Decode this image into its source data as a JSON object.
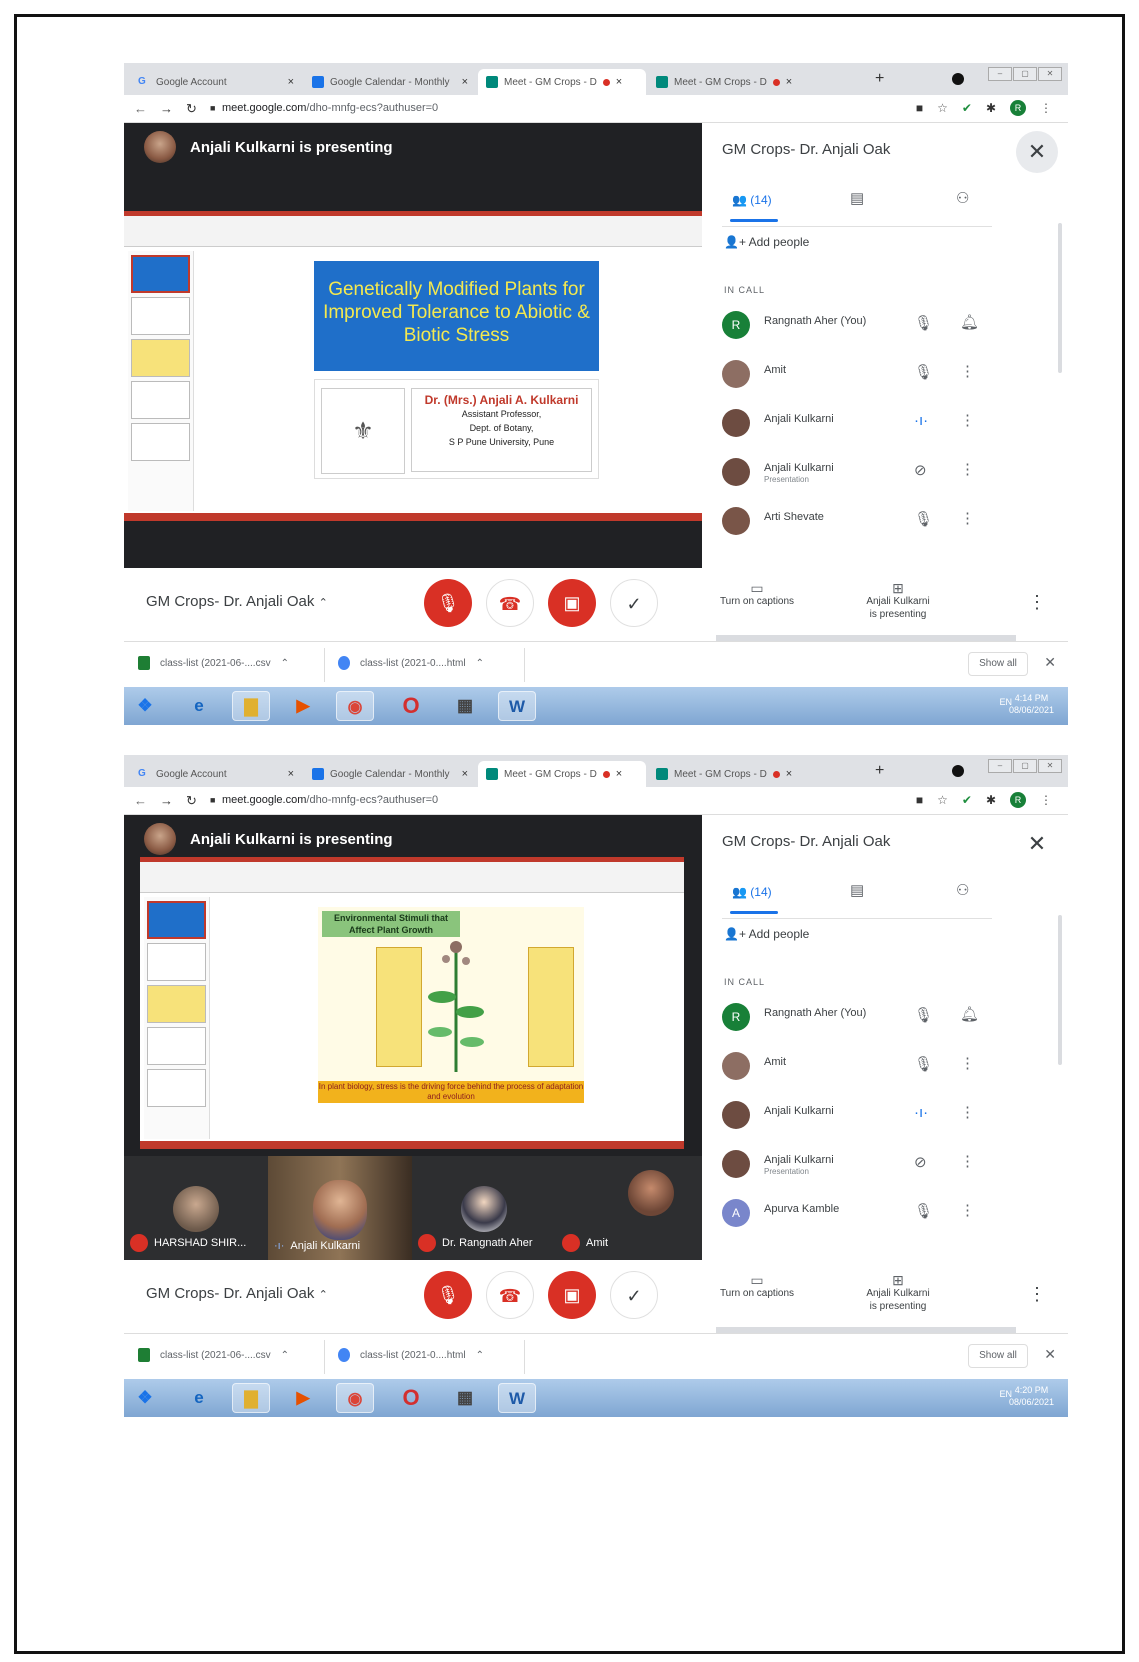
{
  "tabs": [
    "Google Account",
    "Google Calendar - Monthly",
    "Meet - GM Crops - D",
    "Meet - GM Crops - D"
  ],
  "address": {
    "host": "meet.google.com",
    "path": "/dho-mnfg-ecs?authuser=0"
  },
  "meeting_title": "GM Crops- Dr. Anjali Oak",
  "presenting_label": "Anjali Kulkarni is presenting",
  "panel": {
    "people_count": "(14)",
    "add_people": "Add people",
    "in_call": "IN CALL"
  },
  "controls": {
    "captions": "Turn on captions",
    "presenting_line1": "Anjali Kulkarni",
    "presenting_line2": "is presenting"
  },
  "downloads": {
    "file1": "class-list (2021-06-....csv",
    "file2": "class-list (2021-0....html",
    "show_all": "Show all"
  },
  "screenshot1": {
    "slide": {
      "title": "Genetically Modified Plants for Improved Tolerance to Abiotic & Biotic Stress",
      "presenter": "Dr. (Mrs.) Anjali A. Kulkarni",
      "line1": "Assistant Professor,",
      "line2": "Dept. of Botany,",
      "line3": "S P Pune University, Pune"
    },
    "participants": [
      {
        "name": "Rangnath Aher (You)",
        "sub": "",
        "initial": "R",
        "color": "#188038",
        "ic1": "mic-off-icon",
        "ic2": "bell-icon"
      },
      {
        "name": "Amit",
        "sub": "",
        "initial": "",
        "color": "#8d6e63",
        "ic1": "mic-off-icon",
        "ic2": "more-icon"
      },
      {
        "name": "Anjali Kulkarni",
        "sub": "",
        "initial": "",
        "color": "#6d4c41",
        "ic1": "speaking-icon",
        "ic2": "more-icon"
      },
      {
        "name": "Anjali Kulkarni",
        "sub": "Presentation",
        "initial": "",
        "color": "#6d4c41",
        "ic1": "screen-off-icon",
        "ic2": "more-icon"
      },
      {
        "name": "Arti Shevate",
        "sub": "",
        "initial": "",
        "color": "#795548",
        "ic1": "mic-off-icon",
        "ic2": "more-icon"
      }
    ],
    "tray": "EN",
    "clock": {
      "time": "4:14 PM",
      "date": "08/06/2021"
    }
  },
  "screenshot2": {
    "slide": {
      "title": "Environmental Stimuli that Affect Plant Growth",
      "footer": "In plant biology, stress is the driving force behind the process of adaptation and evolution"
    },
    "tiles": [
      "HARSHAD SHIR...",
      "Anjali Kulkarni",
      "Dr. Rangnath Aher",
      "Amit"
    ],
    "participants": [
      {
        "name": "Rangnath Aher (You)",
        "sub": "",
        "initial": "R",
        "color": "#188038",
        "ic1": "mic-off-icon",
        "ic2": "bell-icon"
      },
      {
        "name": "Amit",
        "sub": "",
        "initial": "",
        "color": "#8d6e63",
        "ic1": "mic-off-icon",
        "ic2": "more-icon"
      },
      {
        "name": "Anjali Kulkarni",
        "sub": "",
        "initial": "",
        "color": "#6d4c41",
        "ic1": "speaking-icon",
        "ic2": "more-icon"
      },
      {
        "name": "Anjali Kulkarni",
        "sub": "Presentation",
        "initial": "",
        "color": "#6d4c41",
        "ic1": "screen-off-icon",
        "ic2": "more-icon"
      },
      {
        "name": "Apurva Kamble",
        "sub": "",
        "initial": "A",
        "color": "#7986cb",
        "ic1": "mic-off-icon",
        "ic2": "more-icon"
      }
    ],
    "tray": "EN",
    "clock": {
      "time": "4:20 PM",
      "date": "08/06/2021"
    }
  }
}
